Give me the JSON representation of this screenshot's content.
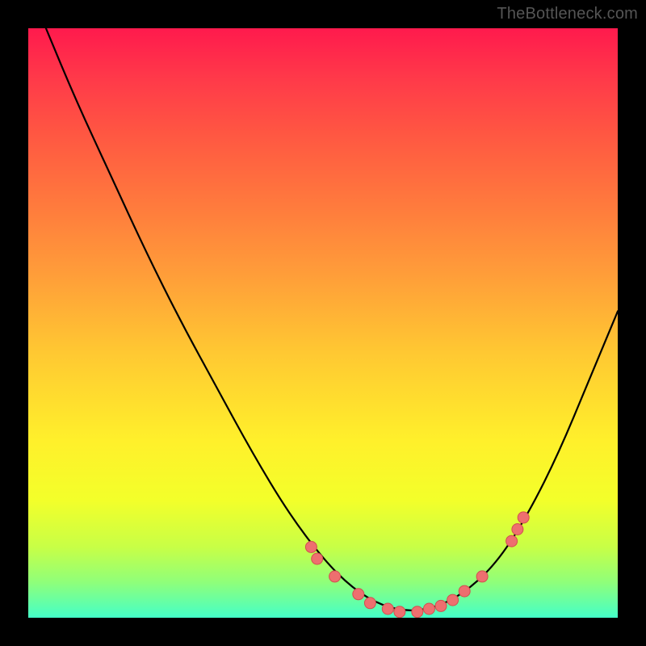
{
  "watermark": "TheBottleneck.com",
  "colors": {
    "frame_bg": "#000000",
    "marker_fill": "#ee6f6f",
    "marker_stroke": "#d24f4f",
    "curve_stroke": "#000000"
  },
  "chart_data": {
    "type": "line",
    "title": "",
    "xlabel": "",
    "ylabel": "",
    "xlim": [
      0,
      100
    ],
    "ylim": [
      0,
      100
    ],
    "grid": false,
    "legend": false,
    "curve": {
      "comment": "Approximate V-shaped bottleneck curve; y is distance from ideal (0 = best, near bottom).",
      "points": [
        {
          "x": 3,
          "y": 100
        },
        {
          "x": 8,
          "y": 88
        },
        {
          "x": 14,
          "y": 75
        },
        {
          "x": 20,
          "y": 62
        },
        {
          "x": 26,
          "y": 50
        },
        {
          "x": 32,
          "y": 39
        },
        {
          "x": 38,
          "y": 28
        },
        {
          "x": 44,
          "y": 18
        },
        {
          "x": 50,
          "y": 10
        },
        {
          "x": 55,
          "y": 5
        },
        {
          "x": 60,
          "y": 2
        },
        {
          "x": 65,
          "y": 1
        },
        {
          "x": 70,
          "y": 2
        },
        {
          "x": 75,
          "y": 5
        },
        {
          "x": 80,
          "y": 10
        },
        {
          "x": 85,
          "y": 18
        },
        {
          "x": 90,
          "y": 28
        },
        {
          "x": 95,
          "y": 40
        },
        {
          "x": 100,
          "y": 52
        }
      ]
    },
    "markers": {
      "comment": "Highlighted sample dots along the valley region.",
      "points": [
        {
          "x": 48,
          "y": 12
        },
        {
          "x": 49,
          "y": 10
        },
        {
          "x": 52,
          "y": 7
        },
        {
          "x": 56,
          "y": 4
        },
        {
          "x": 58,
          "y": 2.5
        },
        {
          "x": 61,
          "y": 1.5
        },
        {
          "x": 63,
          "y": 1
        },
        {
          "x": 66,
          "y": 1
        },
        {
          "x": 68,
          "y": 1.5
        },
        {
          "x": 70,
          "y": 2
        },
        {
          "x": 72,
          "y": 3
        },
        {
          "x": 74,
          "y": 4.5
        },
        {
          "x": 77,
          "y": 7
        },
        {
          "x": 82,
          "y": 13
        },
        {
          "x": 83,
          "y": 15
        },
        {
          "x": 84,
          "y": 17
        }
      ]
    }
  }
}
